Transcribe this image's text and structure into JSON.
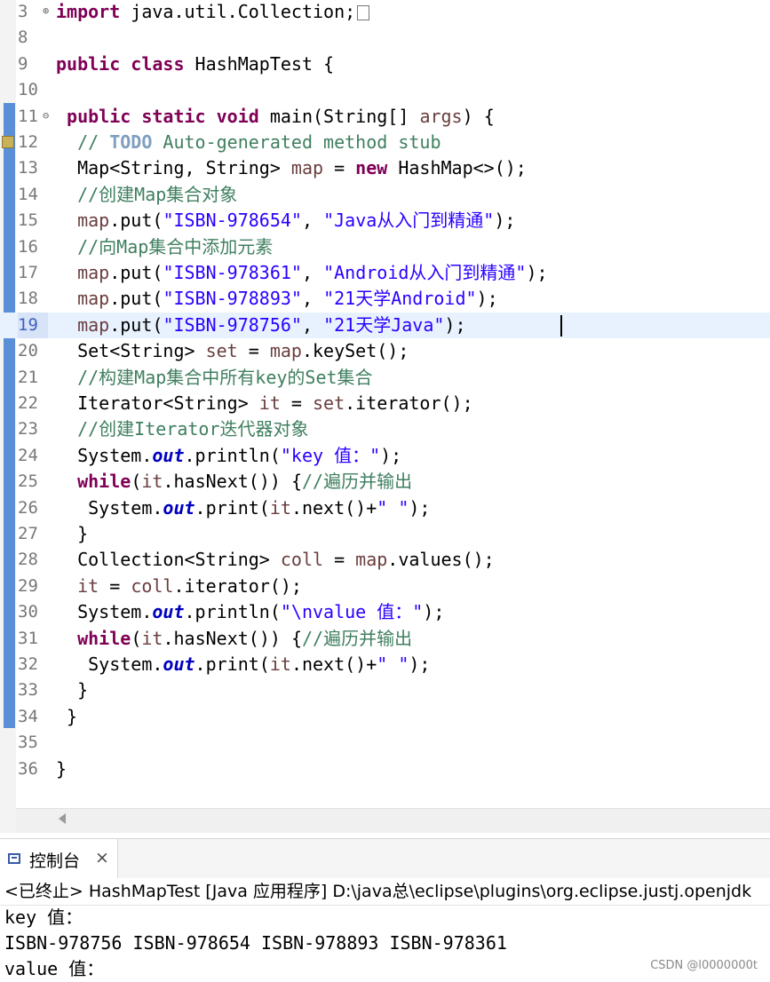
{
  "editor": {
    "lines": [
      {
        "num": "3",
        "fold": "plus",
        "code": [
          {
            "t": "kw",
            "v": "import"
          },
          {
            "t": "",
            "v": " java.util.Collection;"
          },
          {
            "t": "box",
            "v": ""
          }
        ]
      },
      {
        "num": "8",
        "code": []
      },
      {
        "num": "9",
        "code": [
          {
            "t": "kw",
            "v": "public"
          },
          {
            "t": "",
            "v": " "
          },
          {
            "t": "kw",
            "v": "class"
          },
          {
            "t": "",
            "v": " HashMapTest {"
          }
        ]
      },
      {
        "num": "10",
        "code": []
      },
      {
        "num": "11",
        "fold": "minus",
        "code": [
          {
            "t": "",
            "v": " "
          },
          {
            "t": "kw",
            "v": "public"
          },
          {
            "t": "",
            "v": " "
          },
          {
            "t": "kw",
            "v": "static"
          },
          {
            "t": "",
            "v": " "
          },
          {
            "t": "kw",
            "v": "void"
          },
          {
            "t": "",
            "v": " main(String[] "
          },
          {
            "t": "var",
            "v": "args"
          },
          {
            "t": "",
            "v": ") {"
          }
        ]
      },
      {
        "num": "12",
        "warn": true,
        "code": [
          {
            "t": "",
            "v": "  "
          },
          {
            "t": "cm",
            "v": "// "
          },
          {
            "t": "todo",
            "v": "TODO"
          },
          {
            "t": "cm",
            "v": " Auto-generated method stub"
          }
        ]
      },
      {
        "num": "13",
        "code": [
          {
            "t": "",
            "v": "  Map<String, String> "
          },
          {
            "t": "var",
            "v": "map"
          },
          {
            "t": "",
            "v": " = "
          },
          {
            "t": "kw",
            "v": "new"
          },
          {
            "t": "",
            "v": " HashMap<>();"
          }
        ]
      },
      {
        "num": "14",
        "code": [
          {
            "t": "",
            "v": "  "
          },
          {
            "t": "cm",
            "v": "//创建Map集合对象"
          }
        ]
      },
      {
        "num": "15",
        "code": [
          {
            "t": "",
            "v": "  "
          },
          {
            "t": "var",
            "v": "map"
          },
          {
            "t": "",
            "v": ".put("
          },
          {
            "t": "str",
            "v": "\"ISBN-978654\""
          },
          {
            "t": "",
            "v": ", "
          },
          {
            "t": "str",
            "v": "\"Java从入门到精通\""
          },
          {
            "t": "",
            "v": ");"
          }
        ]
      },
      {
        "num": "16",
        "code": [
          {
            "t": "",
            "v": "  "
          },
          {
            "t": "cm",
            "v": "//向Map集合中添加元素"
          }
        ]
      },
      {
        "num": "17",
        "code": [
          {
            "t": "",
            "v": "  "
          },
          {
            "t": "var",
            "v": "map"
          },
          {
            "t": "",
            "v": ".put("
          },
          {
            "t": "str",
            "v": "\"ISBN-978361\""
          },
          {
            "t": "",
            "v": ", "
          },
          {
            "t": "str",
            "v": "\"Android从入门到精通\""
          },
          {
            "t": "",
            "v": ");"
          }
        ]
      },
      {
        "num": "18",
        "code": [
          {
            "t": "",
            "v": "  "
          },
          {
            "t": "var",
            "v": "map"
          },
          {
            "t": "",
            "v": ".put("
          },
          {
            "t": "str",
            "v": "\"ISBN-978893\""
          },
          {
            "t": "",
            "v": ", "
          },
          {
            "t": "str",
            "v": "\"21天学Android\""
          },
          {
            "t": "",
            "v": ");"
          }
        ]
      },
      {
        "num": "19",
        "current": true,
        "code": [
          {
            "t": "",
            "v": "  "
          },
          {
            "t": "var",
            "v": "map"
          },
          {
            "t": "",
            "v": ".put("
          },
          {
            "t": "str",
            "v": "\"ISBN-978756\""
          },
          {
            "t": "",
            "v": ", "
          },
          {
            "t": "str",
            "v": "\"21天学Java\""
          },
          {
            "t": "",
            "v": ");"
          }
        ]
      },
      {
        "num": "20",
        "code": [
          {
            "t": "",
            "v": "  Set<String> "
          },
          {
            "t": "var",
            "v": "set"
          },
          {
            "t": "",
            "v": " = "
          },
          {
            "t": "var",
            "v": "map"
          },
          {
            "t": "",
            "v": ".keySet();"
          }
        ]
      },
      {
        "num": "21",
        "code": [
          {
            "t": "",
            "v": "  "
          },
          {
            "t": "cm",
            "v": "//构建Map集合中所有key的Set集合"
          }
        ]
      },
      {
        "num": "22",
        "code": [
          {
            "t": "",
            "v": "  Iterator<String> "
          },
          {
            "t": "var",
            "v": "it"
          },
          {
            "t": "",
            "v": " = "
          },
          {
            "t": "var",
            "v": "set"
          },
          {
            "t": "",
            "v": ".iterator();"
          }
        ]
      },
      {
        "num": "23",
        "code": [
          {
            "t": "",
            "v": "  "
          },
          {
            "t": "cm",
            "v": "//创建Iterator迭代器对象"
          }
        ]
      },
      {
        "num": "24",
        "code": [
          {
            "t": "",
            "v": "  System."
          },
          {
            "t": "fld",
            "v": "out"
          },
          {
            "t": "",
            "v": ".println("
          },
          {
            "t": "str",
            "v": "\"key 值：\""
          },
          {
            "t": "",
            "v": ");"
          }
        ]
      },
      {
        "num": "25",
        "code": [
          {
            "t": "",
            "v": "  "
          },
          {
            "t": "kw",
            "v": "while"
          },
          {
            "t": "",
            "v": "("
          },
          {
            "t": "var",
            "v": "it"
          },
          {
            "t": "",
            "v": ".hasNext()) {"
          },
          {
            "t": "cm",
            "v": "//遍历并输出"
          }
        ]
      },
      {
        "num": "26",
        "code": [
          {
            "t": "",
            "v": "   System."
          },
          {
            "t": "fld",
            "v": "out"
          },
          {
            "t": "",
            "v": ".print("
          },
          {
            "t": "var",
            "v": "it"
          },
          {
            "t": "",
            "v": ".next()+"
          },
          {
            "t": "str",
            "v": "\" \""
          },
          {
            "t": "",
            "v": ");"
          }
        ]
      },
      {
        "num": "27",
        "code": [
          {
            "t": "",
            "v": "  }"
          }
        ]
      },
      {
        "num": "28",
        "code": [
          {
            "t": "",
            "v": "  Collection<String> "
          },
          {
            "t": "var",
            "v": "coll"
          },
          {
            "t": "",
            "v": " = "
          },
          {
            "t": "var",
            "v": "map"
          },
          {
            "t": "",
            "v": ".values();"
          }
        ]
      },
      {
        "num": "29",
        "code": [
          {
            "t": "",
            "v": "  "
          },
          {
            "t": "var",
            "v": "it"
          },
          {
            "t": "",
            "v": " = "
          },
          {
            "t": "var",
            "v": "coll"
          },
          {
            "t": "",
            "v": ".iterator();"
          }
        ]
      },
      {
        "num": "30",
        "code": [
          {
            "t": "",
            "v": "  System."
          },
          {
            "t": "fld",
            "v": "out"
          },
          {
            "t": "",
            "v": ".println("
          },
          {
            "t": "str",
            "v": "\"\\nvalue 值：\""
          },
          {
            "t": "",
            "v": ");"
          }
        ]
      },
      {
        "num": "31",
        "code": [
          {
            "t": "",
            "v": "  "
          },
          {
            "t": "kw",
            "v": "while"
          },
          {
            "t": "",
            "v": "("
          },
          {
            "t": "var",
            "v": "it"
          },
          {
            "t": "",
            "v": ".hasNext()) {"
          },
          {
            "t": "cm",
            "v": "//遍历并输出"
          }
        ]
      },
      {
        "num": "32",
        "code": [
          {
            "t": "",
            "v": "   System."
          },
          {
            "t": "fld",
            "v": "out"
          },
          {
            "t": "",
            "v": ".print("
          },
          {
            "t": "var",
            "v": "it"
          },
          {
            "t": "",
            "v": ".next()+"
          },
          {
            "t": "str",
            "v": "\" \""
          },
          {
            "t": "",
            "v": ");"
          }
        ]
      },
      {
        "num": "33",
        "code": [
          {
            "t": "",
            "v": "  }"
          }
        ]
      },
      {
        "num": "34",
        "code": [
          {
            "t": "",
            "v": " }"
          }
        ]
      },
      {
        "num": "35",
        "code": []
      },
      {
        "num": "36",
        "code": [
          {
            "t": "",
            "v": "}"
          }
        ]
      }
    ]
  },
  "console": {
    "tab_label": "控制台",
    "close_symbol": "×",
    "header": "<已终止> HashMapTest [Java 应用程序] D:\\java总\\eclipse\\plugins\\org.eclipse.justj.openjdk",
    "output": [
      "key 值：",
      "ISBN-978756 ISBN-978654 ISBN-978893 ISBN-978361",
      "value 值："
    ]
  },
  "watermark": "CSDN @l0000000t",
  "colors": {
    "keyword": "#7f0055",
    "string": "#2a00ff",
    "comment": "#3f7f5f",
    "current_line": "#e8f2fe",
    "ruler_marker": "#5a8fd8"
  }
}
